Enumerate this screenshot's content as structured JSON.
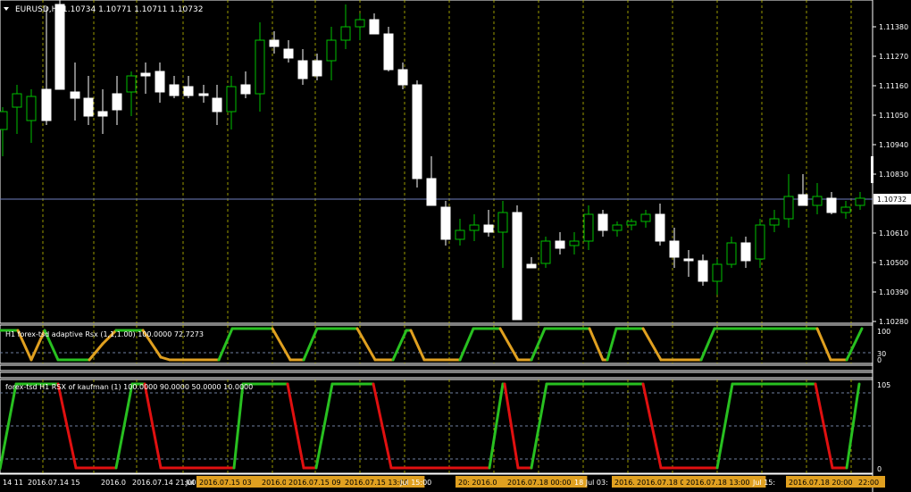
{
  "main": {
    "symbol": "EURUSD,H1",
    "ohlc": "1.10734 1.10771 1.10711 1.10732",
    "price_labels": [
      "1.11380",
      "1.11270",
      "1.11160",
      "1.11050",
      "1.10940",
      "1.10830",
      "1.10610",
      "1.10500",
      "1.10390",
      "1.10280"
    ],
    "current_price": "1.10732",
    "colors": {
      "bull": "#00c000",
      "bear": "#ffffff",
      "grid": "#c0c000",
      "price_line": "#7080c0",
      "axis": "#ffffff",
      "bg": "#000000"
    }
  },
  "rsx_panel": {
    "title": "H1 forex-tsd adaptive Rsx (1,1,1.00) 100.0000 72.7273",
    "levels": [
      "100",
      "30",
      "0"
    ],
    "colors": {
      "up": "#28c020",
      "down": "#e0a020"
    }
  },
  "kaufman_panel": {
    "title": "forex-tsd H1  RSX of kaufman (1) 100.0000 90.0000 50.0000 10.0000",
    "levels": [
      "105",
      "0"
    ],
    "colors": {
      "up": "#28c020",
      "down": "#e01010"
    }
  },
  "time_axis": {
    "labels": [
      {
        "text": "14 11",
        "hl": false
      },
      {
        "text": "2016.07.14 15",
        "hl": false
      },
      {
        "text": "2016.0",
        "hl": false
      },
      {
        "text": "2016.07.14 21:00",
        "hl": false
      },
      {
        "text": "Jul",
        "hl": false
      },
      {
        "text": "2016.07.15 03",
        "hl": true
      },
      {
        "text": "2016.0",
        "hl": true
      },
      {
        "text": "2016.07.15 09",
        "hl": true
      },
      {
        "text": "2016.07.15 13:00",
        "hl": true
      },
      {
        "text": "Jul 15:00",
        "hl": false
      },
      {
        "text": "20: 2016.0",
        "hl": true
      },
      {
        "text": "2016.07.18 00:00",
        "hl": true
      },
      {
        "text": "18 Jul 03:",
        "hl": false
      },
      {
        "text": "2016.0",
        "hl": true
      },
      {
        "text": "2016.07.18 08:00",
        "hl": true
      },
      {
        "text": "2016.07.18 13:00",
        "hl": true
      },
      {
        "text": "Jul 15:",
        "hl": false
      },
      {
        "text": "2016.07.18 20:00",
        "hl": true
      },
      {
        "text": "22:00",
        "hl": true
      }
    ]
  }
}
